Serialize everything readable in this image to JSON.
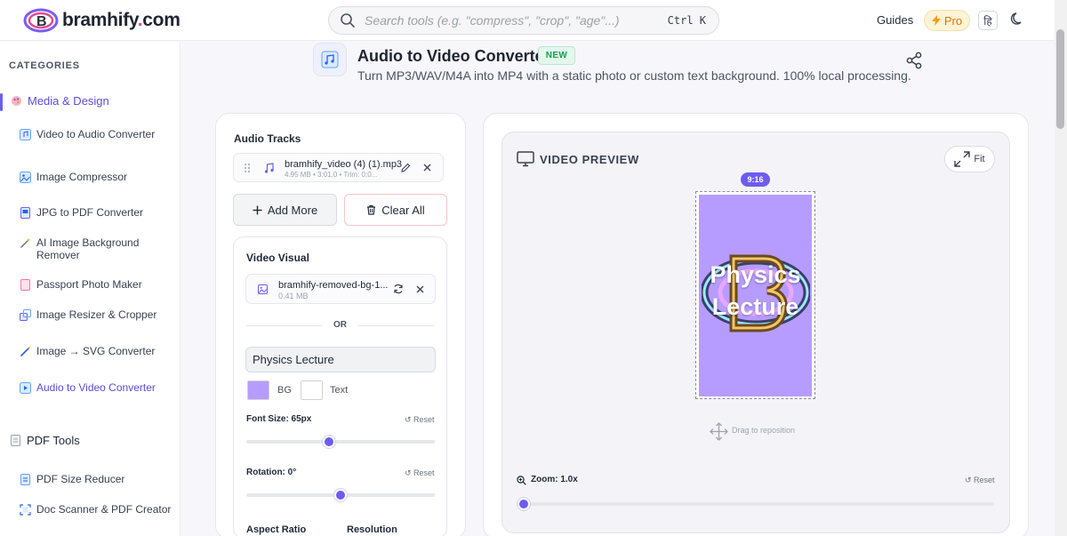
{
  "header": {
    "logo_text": "bramhify",
    "logo_dot": ".",
    "logo_tld": "com",
    "search_placeholder": "Search tools (e.g. \"compress\", \"crop\", \"age\"...)",
    "search_shortcut": "Ctrl K",
    "guides_label": "Guides",
    "pro_label": "Pro",
    "lang_label": "हि"
  },
  "sidebar": {
    "title": "CATEGORIES",
    "groups": [
      {
        "label": "Media & Design",
        "items": [
          {
            "label": "Video to Audio Converter"
          },
          {
            "label": "Image Compressor"
          },
          {
            "label": "JPG to PDF Converter"
          },
          {
            "label": "AI Image Background Remover"
          },
          {
            "label": "Passport Photo Maker"
          },
          {
            "label": "Image Resizer & Cropper"
          },
          {
            "label": "Image → SVG Converter"
          },
          {
            "label": "Audio to Video Converter"
          }
        ]
      },
      {
        "label": "PDF Tools",
        "items": [
          {
            "label": "PDF Size Reducer"
          },
          {
            "label": "Doc Scanner & PDF Creator"
          }
        ]
      }
    ]
  },
  "tool": {
    "title": "Audio to Video Converter",
    "badge": "NEW",
    "subtitle": "Turn MP3/WAV/M4A into MP4 with a static photo or custom text background. 100% local processing."
  },
  "audio": {
    "heading": "Audio Tracks",
    "track_name": "bramhify_video (4) (1).mp3",
    "track_meta": "4.95 MB • 3:01.0 • Trim: 0:0...",
    "add_more_label": "Add More",
    "clear_all_label": "Clear All"
  },
  "visual": {
    "heading": "Video Visual",
    "file_name": "bramhify-removed-bg-1...",
    "file_size": "0.41 MB",
    "or_label": "OR",
    "text_value": "Physics Lecture",
    "bg_label": "BG",
    "text_color_label": "Text",
    "bg_color": "#b69cff",
    "text_color": "#ffffff",
    "font_size_label": "Font Size: 65px",
    "font_size_fraction": 0.44,
    "rotation_label": "Rotation: 0°",
    "rotation_fraction": 0.5,
    "reset_label": "Reset",
    "aspect_ratio_label": "Aspect Ratio",
    "resolution_label": "Resolution"
  },
  "preview": {
    "heading": "VIDEO PREVIEW",
    "fit_label": "Fit",
    "ratio_label": "9:16",
    "text_line1": "Physics",
    "text_line2": "Lecture",
    "drag_hint": "Drag to reposition",
    "zoom_label": "Zoom: 1.0x",
    "zoom_fraction": 0.0,
    "reset_label": "Reset"
  },
  "colors": {
    "accent": "#6d5cf0",
    "pro": "#d97706",
    "new_badge": "#16a34a"
  }
}
